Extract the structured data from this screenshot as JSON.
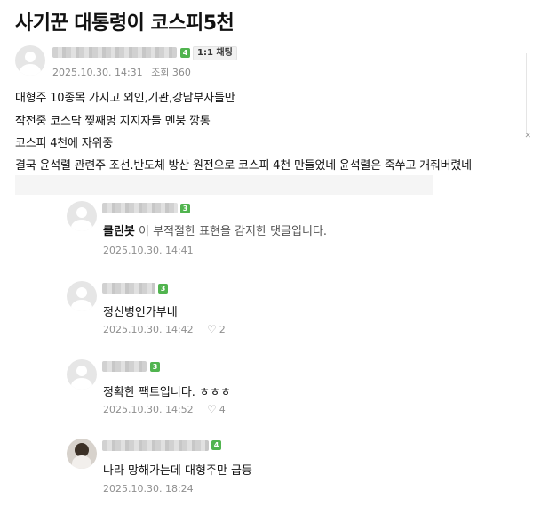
{
  "post": {
    "title": "사기꾼 대통령이 코스피5천",
    "author_level": "4",
    "chat_label": "1:1 채팅",
    "date": "2025.10.30. 14:31",
    "views": "조회 360",
    "lines": [
      "대형주 10종목 가지고 외인,기관,강남부자들만",
      "작전중 코스닥 찢째명 지지자들 멘붕 깡통",
      "코스피 4천에 자위중",
      "결국 윤석렬 관련주 조선.반도체 방산 원전으로 코스피 4천 만들었네  윤석렬은 죽쑤고 개줘버렸네"
    ]
  },
  "comments": [
    {
      "level": "3",
      "clean_label": "클린봇",
      "text": " 이 부적절한 표현을 감지한 댓글입니다.",
      "date": "2025.10.30. 14:41",
      "likes": ""
    },
    {
      "level": "3",
      "text": "정신병인가부네",
      "date": "2025.10.30. 14:42",
      "likes": "2"
    },
    {
      "level": "3",
      "text": "정확한 팩트입니다. ㅎㅎㅎ",
      "date": "2025.10.30. 14:52",
      "likes": "4"
    },
    {
      "level": "4",
      "text": "나라 망해가는데 대형주만 급등",
      "date": "2025.10.30. 18:24",
      "likes": ""
    }
  ],
  "icons": {
    "heart": "heart-outline-icon",
    "avatar": "default-avatar-icon"
  },
  "colors": {
    "level_badge": "#51b44f",
    "meta_text": "#8a8a8a"
  }
}
